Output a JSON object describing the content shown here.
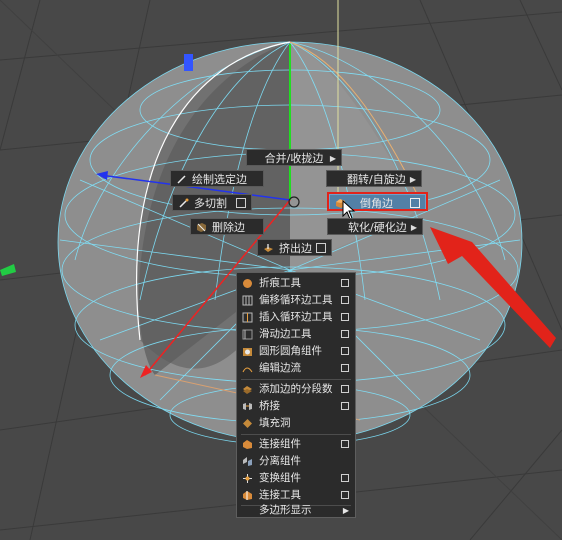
{
  "colors": {
    "highlight": "#5280a6",
    "annotation": "#e2231a",
    "wire": "#7fe5ff",
    "background": "#484848"
  },
  "marking_menu": {
    "north": {
      "label": "合并/收拢边",
      "icon": "submenu-arrow"
    },
    "northeast": {
      "label": "翻转/自旋边",
      "icon": "submenu-arrow"
    },
    "east": {
      "label": "倒角边",
      "icon": "bevel-icon"
    },
    "southeast": {
      "label": "软化/硬化边",
      "icon": "submenu-arrow"
    },
    "south": {
      "label": "挤出边",
      "icon": "extrude-icon"
    },
    "southwest": {
      "label": "删除边",
      "icon": "delete-edge-icon"
    },
    "west": {
      "label": "多切割",
      "icon": "multicut-icon"
    },
    "northwest": {
      "label": "绘制选定边",
      "icon": "paint-edge-icon"
    }
  },
  "dropdown": {
    "items": [
      {
        "label": "折痕工具",
        "icon": "crease-icon",
        "has_option": true
      },
      {
        "label": "偏移循环边工具",
        "icon": "offset-loop-icon",
        "has_option": true
      },
      {
        "label": "插入循环边工具",
        "icon": "insert-loop-icon",
        "has_option": true
      },
      {
        "label": "滑动边工具",
        "icon": "slide-edge-icon",
        "has_option": true
      },
      {
        "label": "圆形圆角组件",
        "icon": "circularize-icon",
        "has_option": true
      },
      {
        "label": "编辑边流",
        "icon": "edit-flow-icon",
        "has_option": true
      },
      {
        "label": "添加边的分段数",
        "icon": "add-divisions-icon",
        "has_option": true
      },
      {
        "label": "桥接",
        "icon": "bridge-icon",
        "has_option": true
      },
      {
        "label": "填充洞",
        "icon": "fill-hole-icon",
        "has_option": false
      },
      {
        "label": "连接组件",
        "icon": "connect-components-icon",
        "has_option": true
      },
      {
        "label": "分离组件",
        "icon": "detach-components-icon",
        "has_option": false
      },
      {
        "label": "变换组件",
        "icon": "transform-component-icon",
        "has_option": true
      },
      {
        "label": "连接工具",
        "icon": "connect-tool-icon",
        "has_option": true
      }
    ],
    "submenu": {
      "label": "多边形显示"
    }
  }
}
